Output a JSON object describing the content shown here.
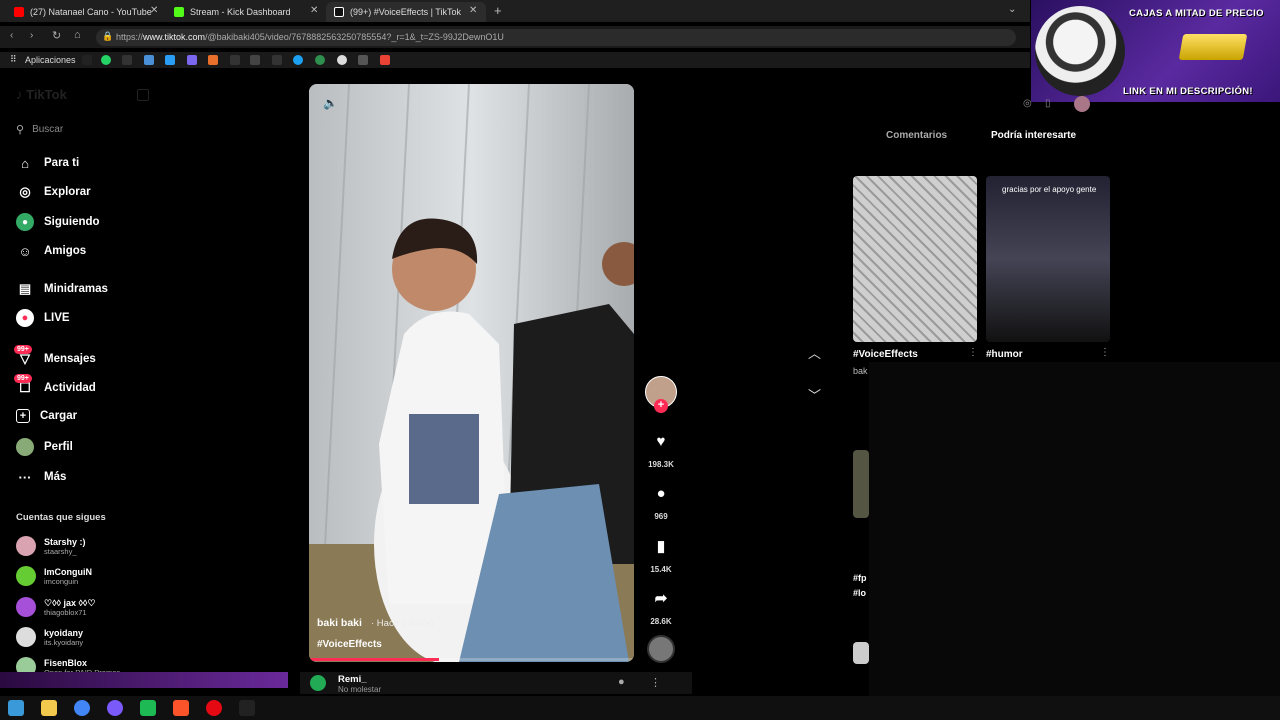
{
  "browser": {
    "tabs": [
      {
        "title": "(27) Natanael Cano - YouTube",
        "color": "#ff0000"
      },
      {
        "title": "Stream - Kick Dashboard",
        "color": "#53fc18"
      },
      {
        "title": "(99+) #VoiceEffects | TikTok",
        "color": "#ffffff"
      }
    ],
    "url_prefix": "https://",
    "url_domain": "www.tiktok.com",
    "url_path": "/@bakibaki405/video/7678882563250785554?_r=1&_t=ZS-99J2DewnO1U",
    "bookmarks_label": "Aplicaciones"
  },
  "promo": {
    "top_text": "CAJAS A MITAD DE PRECIO",
    "bottom_text": "LINK EN MI DESCRIPCIÓN!"
  },
  "sidebar": {
    "search_placeholder": "Buscar",
    "items": [
      {
        "label": "Para ti",
        "icon": "home-icon"
      },
      {
        "label": "Explorar",
        "icon": "compass-icon"
      },
      {
        "label": "Siguiendo",
        "icon": "following-icon"
      },
      {
        "label": "Amigos",
        "icon": "friends-icon"
      },
      {
        "label": "Minidramas",
        "icon": "minidramas-icon"
      },
      {
        "label": "LIVE",
        "icon": "live-icon"
      },
      {
        "label": "Mensajes",
        "icon": "messages-icon",
        "badge": "99+"
      },
      {
        "label": "Actividad",
        "icon": "activity-icon",
        "badge": "99+"
      },
      {
        "label": "Cargar",
        "icon": "upload-icon"
      },
      {
        "label": "Perfil",
        "icon": "profile-icon"
      },
      {
        "label": "Más",
        "icon": "more-icon"
      }
    ],
    "following_title": "Cuentas que sigues",
    "following": [
      {
        "name": "Starshy :)",
        "handle": "staarshy_"
      },
      {
        "name": "ImConguiN",
        "handle": "imconguin"
      },
      {
        "name": "♡◊◊ jax ◊◊♡",
        "handle": "thiagoblox71"
      },
      {
        "name": "kyoidany",
        "handle": "its.kyoidany"
      },
      {
        "name": "FisenBlox",
        "handle": "Open for PAID Promos"
      }
    ]
  },
  "video": {
    "author": "baki baki",
    "time": "· Hace 2 día(s)",
    "hashtag": "#VoiceEffects",
    "progress": 0.4
  },
  "actions": {
    "likes": "198.3K",
    "comments": "969",
    "saves": "15.4K",
    "shares": "28.6K"
  },
  "right_panel": {
    "tab_comments": "Comentarios",
    "tab_interest": "Podría interesarte",
    "cards": [
      {
        "tag": "#VoiceEffects",
        "author": "bak"
      },
      {
        "tag": "#humor",
        "overlay_text": "gracias por el apoyo gente"
      }
    ],
    "lower_tags": [
      "#fp",
      "#lo"
    ]
  },
  "bottom_bar": {
    "name": "Remi_",
    "status": "No molestar"
  }
}
